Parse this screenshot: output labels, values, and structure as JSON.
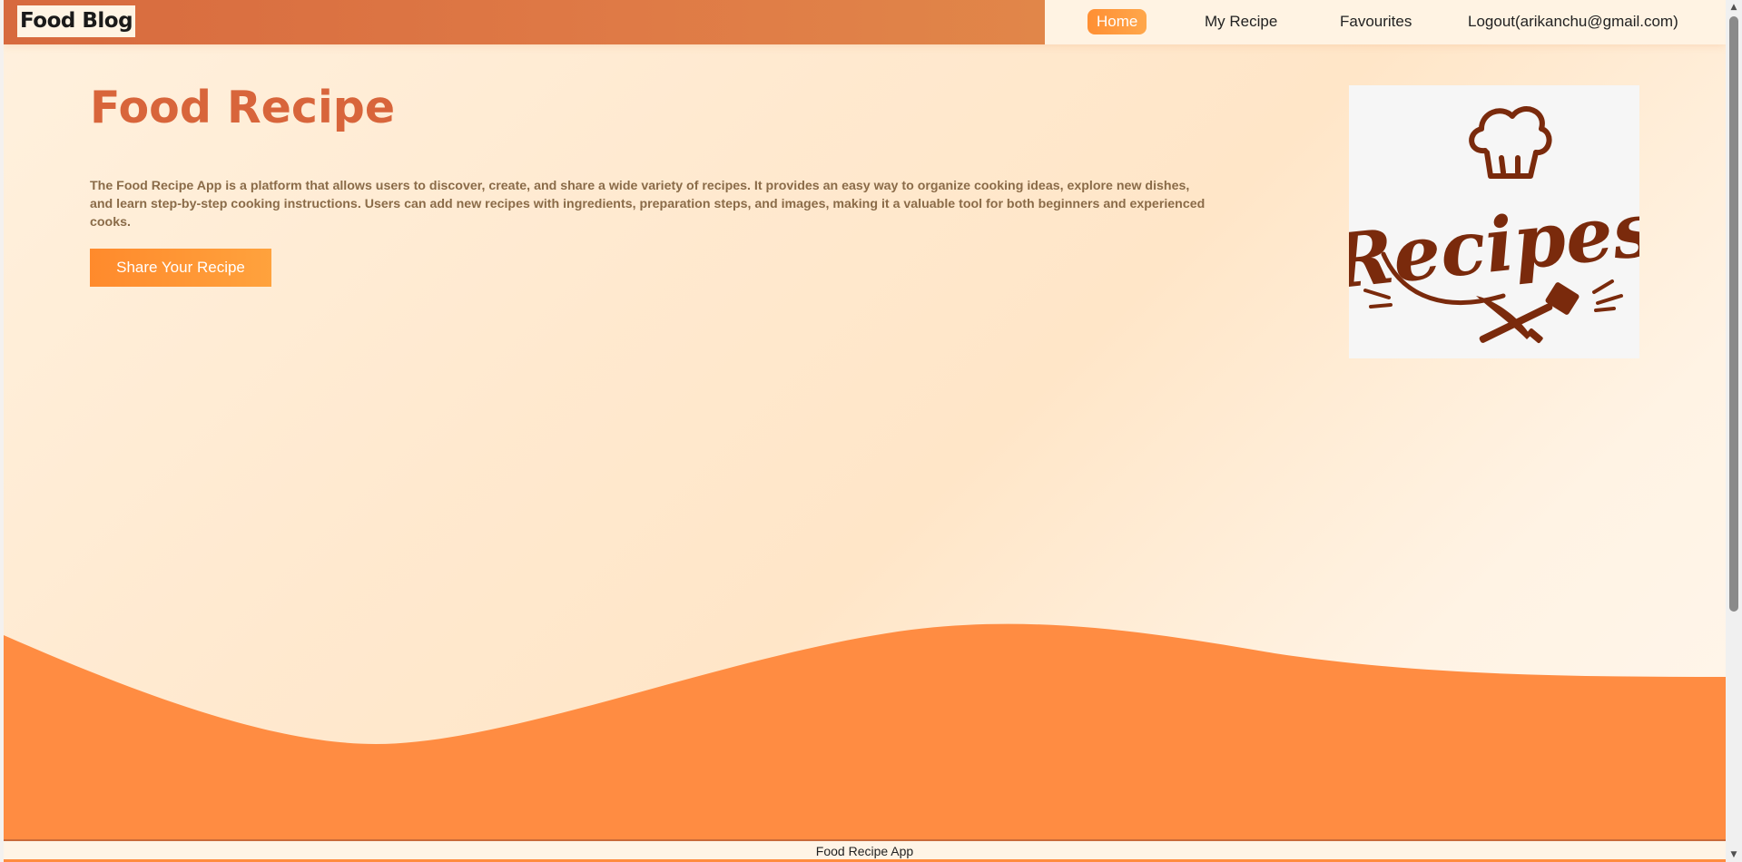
{
  "header": {
    "brand": "Food Blog",
    "nav": [
      {
        "label": "Home",
        "active": true
      },
      {
        "label": "My Recipe",
        "active": false
      },
      {
        "label": "Favourites",
        "active": false
      },
      {
        "label": "Logout(arikanchu@gmail.com)",
        "active": false
      }
    ]
  },
  "hero": {
    "title": "Food Recipe",
    "description": "The Food Recipe App is a platform that allows users to discover, create, and share a wide variety of recipes. It provides an easy way to organize cooking ideas, explore new dishes, and learn step-by-step cooking instructions. Users can add new recipes with ingredients, preparation steps, and images, making it a valuable tool for both beginners and experienced cooks.",
    "cta_label": "Share Your Recipe",
    "logo_text": "Recipes"
  },
  "footer": {
    "text": "Food Recipe App"
  },
  "colors": {
    "accent": "#ff8c3f",
    "brand_bar": "#d76a3e",
    "title": "#d8653b",
    "logo": "#7a2a0c"
  },
  "icons": [
    "chef-hat-icon",
    "knife-icon",
    "spatula-icon",
    "scroll-up-arrow-icon",
    "scroll-down-arrow-icon"
  ]
}
